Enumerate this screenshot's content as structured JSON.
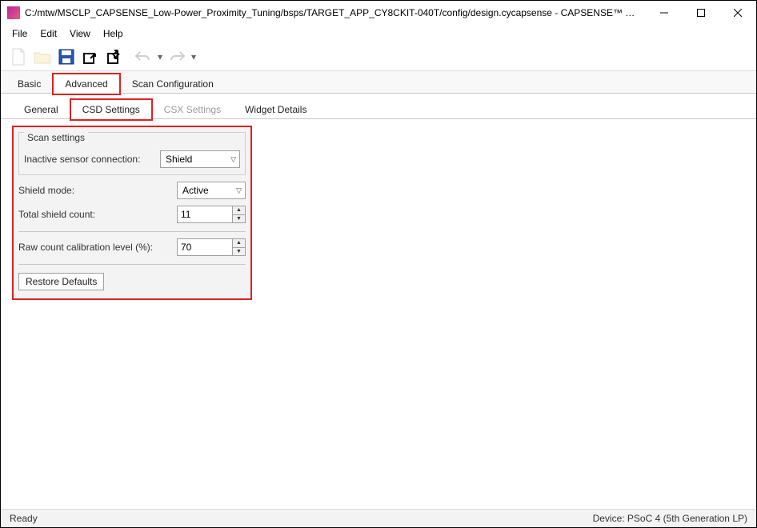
{
  "window": {
    "title": "C:/mtw/MSCLP_CAPSENSE_Low-Power_Proximity_Tuning/bsps/TARGET_APP_CY8CKIT-040T/config/design.cycapsense - CAPSENSE™ Configurato..."
  },
  "menu": {
    "file": "File",
    "edit": "Edit",
    "view": "View",
    "help": "Help"
  },
  "main_tabs": {
    "basic": "Basic",
    "advanced": "Advanced",
    "scan_config": "Scan Configuration"
  },
  "sub_tabs": {
    "general": "General",
    "csd": "CSD Settings",
    "csx": "CSX Settings",
    "widget": "Widget Details"
  },
  "scan_settings": {
    "group_title": "Scan settings",
    "inactive_label": "Inactive sensor connection:",
    "inactive_value": "Shield",
    "shield_mode_label": "Shield mode:",
    "shield_mode_value": "Active",
    "total_shield_label": "Total shield count:",
    "total_shield_value": "11",
    "raw_count_label": "Raw count calibration level (%):",
    "raw_count_value": "70",
    "restore_label": "Restore Defaults"
  },
  "status": {
    "ready": "Ready",
    "device": "Device: PSoC 4 (5th Generation LP)"
  }
}
